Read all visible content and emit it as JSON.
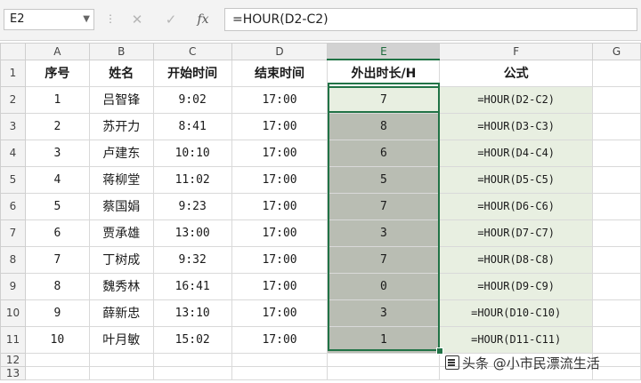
{
  "formula_bar": {
    "name_box": "E2",
    "cancel_icon": "✕",
    "enter_icon": "✓",
    "fx_label": "fx",
    "formula": "=HOUR(D2-C2)"
  },
  "columns": [
    "A",
    "B",
    "C",
    "D",
    "E",
    "F",
    "G"
  ],
  "selected_column": "E",
  "header_row": {
    "a": "序号",
    "b": "姓名",
    "c": "开始时间",
    "d": "结束时间",
    "e": "外出时长/H",
    "f": "公式"
  },
  "rows": [
    {
      "num": "2",
      "a": "1",
      "b": "吕智锋",
      "c": "9:02",
      "d": "17:00",
      "e": "7",
      "f": "=HOUR(D2-C2)"
    },
    {
      "num": "3",
      "a": "2",
      "b": "苏开力",
      "c": "8:41",
      "d": "17:00",
      "e": "8",
      "f": "=HOUR(D3-C3)"
    },
    {
      "num": "4",
      "a": "3",
      "b": "卢建东",
      "c": "10:10",
      "d": "17:00",
      "e": "6",
      "f": "=HOUR(D4-C4)"
    },
    {
      "num": "5",
      "a": "4",
      "b": "蒋柳堂",
      "c": "11:02",
      "d": "17:00",
      "e": "5",
      "f": "=HOUR(D5-C5)"
    },
    {
      "num": "6",
      "a": "5",
      "b": "蔡国娟",
      "c": "9:23",
      "d": "17:00",
      "e": "7",
      "f": "=HOUR(D6-C6)"
    },
    {
      "num": "7",
      "a": "6",
      "b": "贾承雄",
      "c": "13:00",
      "d": "17:00",
      "e": "3",
      "f": "=HOUR(D7-C7)"
    },
    {
      "num": "8",
      "a": "7",
      "b": "丁树成",
      "c": "9:32",
      "d": "17:00",
      "e": "7",
      "f": "=HOUR(D8-C8)"
    },
    {
      "num": "9",
      "a": "8",
      "b": "魏秀林",
      "c": "16:41",
      "d": "17:00",
      "e": "0",
      "f": "=HOUR(D9-C9)"
    },
    {
      "num": "10",
      "a": "9",
      "b": "薛新忠",
      "c": "13:10",
      "d": "17:00",
      "e": "3",
      "f": "=HOUR(D10-C10)"
    },
    {
      "num": "11",
      "a": "10",
      "b": "叶月敏",
      "c": "15:02",
      "d": "17:00",
      "e": "1",
      "f": "=HOUR(D11-C11)"
    }
  ],
  "row_numbers": {
    "first": "1",
    "r12": "12",
    "r13": "13"
  },
  "watermark": "头条 @小市民漂流生活",
  "colors": {
    "accent": "#217346",
    "selection_fill": "#b9bdb3",
    "formula_fill": "#e8efe1"
  }
}
